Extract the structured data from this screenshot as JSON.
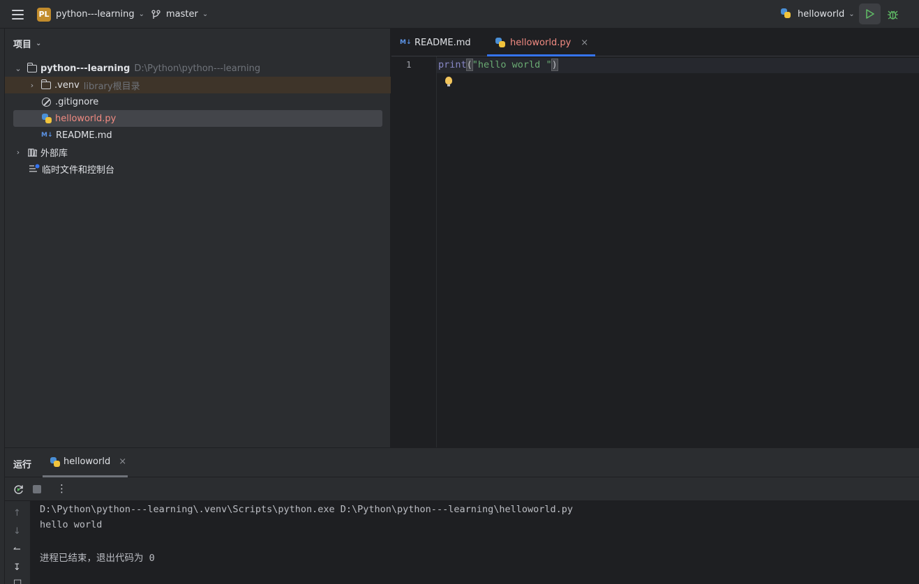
{
  "topbar": {
    "project_badge": "PL",
    "project_name": "python---learning",
    "branch": "master",
    "run_config": "helloworld"
  },
  "project_panel": {
    "title": "项目",
    "root": {
      "name": "python---learning",
      "path": "D:\\Python\\python---learning"
    },
    "items": [
      {
        "name": ".venv",
        "hint": "library根目录"
      },
      {
        "name": ".gitignore"
      },
      {
        "name": "helloworld.py"
      },
      {
        "name": "README.md"
      },
      {
        "name": "外部库"
      },
      {
        "name": "临时文件和控制台"
      }
    ]
  },
  "editor": {
    "tabs": [
      {
        "label": "README.md"
      },
      {
        "label": "helloworld.py"
      }
    ],
    "line_number": "1",
    "code": {
      "fn": "print",
      "open": "(",
      "str": "\"hello world \"",
      "close": ")"
    }
  },
  "run_panel": {
    "title": "运行",
    "tab": "helloworld",
    "output": [
      "D:\\Python\\python---learning\\.venv\\Scripts\\python.exe D:\\Python\\python---learning\\helloworld.py",
      "hello world",
      "",
      "进程已结束，退出代码为 0"
    ]
  },
  "icons": {
    "menu": "hamburger-icon",
    "branch": "git-branch-icon",
    "run": "play-icon",
    "debug": "bug-icon",
    "more": "more-vertical-icon"
  },
  "colors": {
    "accent": "#3574f0",
    "run_green": "#5fb865",
    "badge": "#c28c2c",
    "modified_file": "#f28b82"
  }
}
